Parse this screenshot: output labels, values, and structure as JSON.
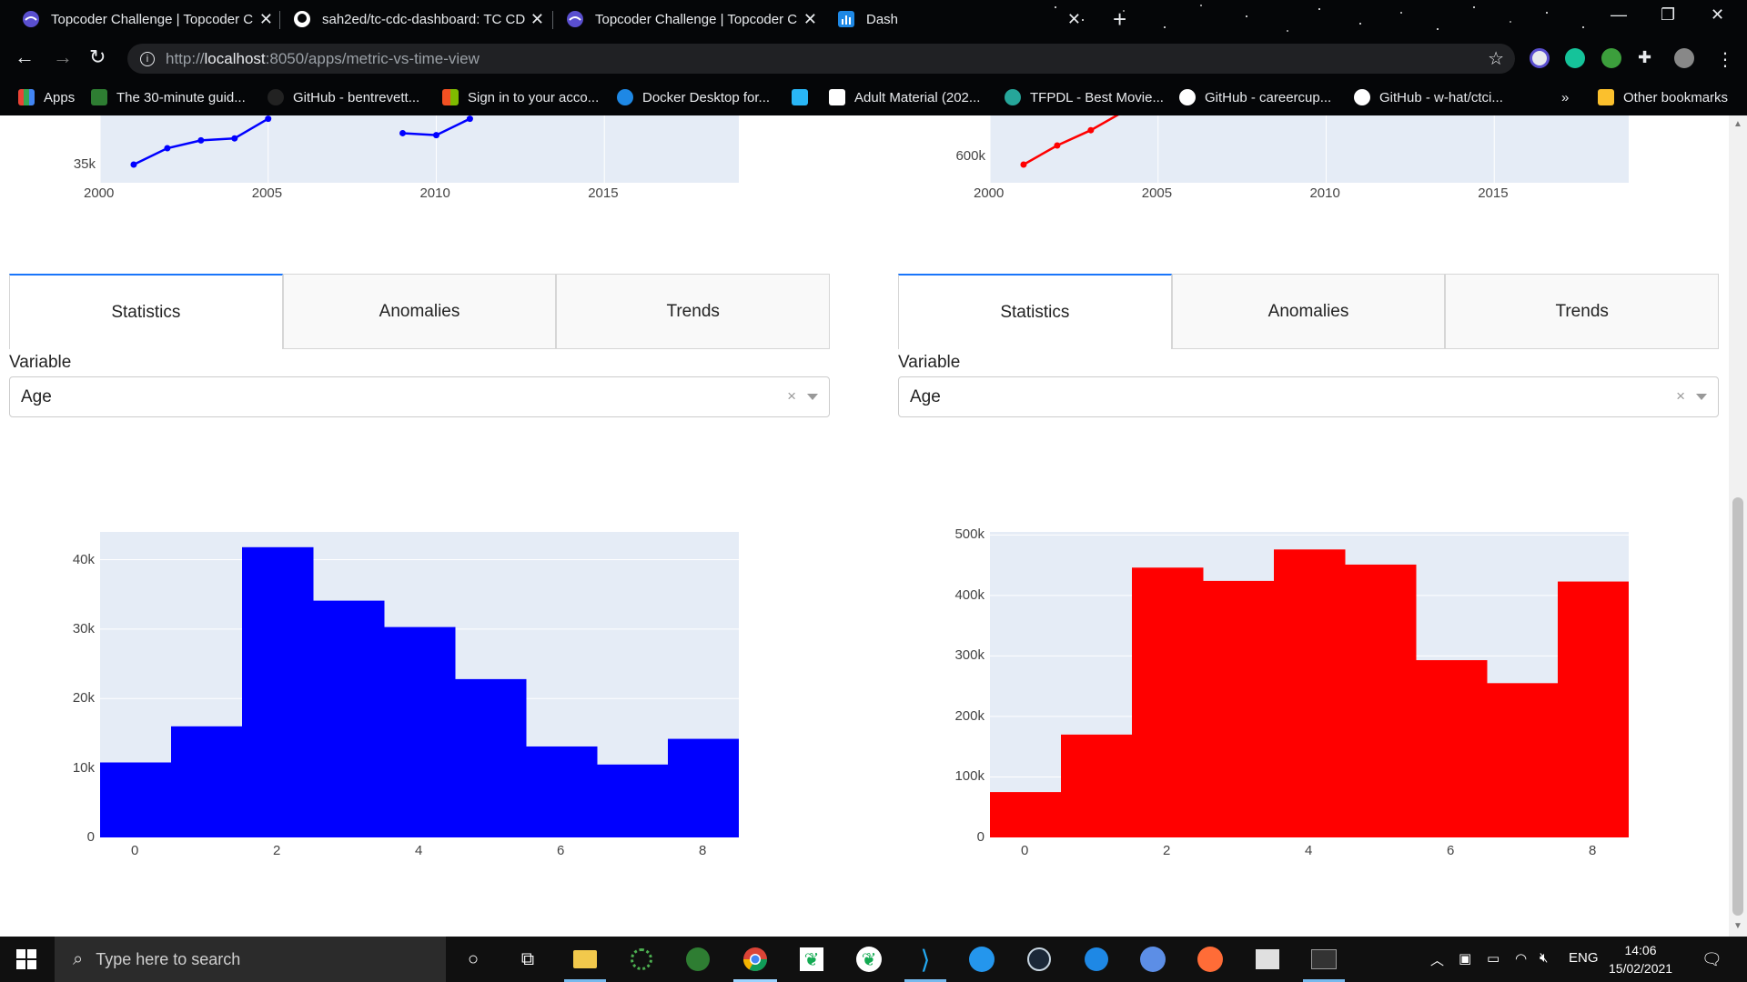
{
  "browser": {
    "tabs": [
      {
        "title": "Topcoder Challenge | Topcoder C",
        "icon": "topcoder-icon"
      },
      {
        "title": "sah2ed/tc-cdc-dashboard: TC CD",
        "icon": "github-icon"
      },
      {
        "title": "Topcoder Challenge | Topcoder C",
        "icon": "topcoder-icon"
      },
      {
        "title": "Dash",
        "icon": "dash-icon"
      }
    ],
    "url_prefix": "http://",
    "url_host": "localhost",
    "url_rest": ":8050/apps/metric-vs-time-view",
    "bookmarks": [
      {
        "label": "Apps"
      },
      {
        "label": "The 30-minute guid..."
      },
      {
        "label": "GitHub - bentrevett..."
      },
      {
        "label": "Sign in to your acco..."
      },
      {
        "label": "Docker Desktop for..."
      },
      {
        "label": ""
      },
      {
        "label": "Adult Material (202..."
      },
      {
        "label": "TFPDL - Best Movie..."
      },
      {
        "label": "GitHub - careercup..."
      },
      {
        "label": "GitHub - w-hat/ctci..."
      }
    ],
    "bookmarks_overflow": "»",
    "other_bookmarks": "Other bookmarks"
  },
  "panels": {
    "left": {
      "tabs": [
        "Statistics",
        "Anomalies",
        "Trends"
      ],
      "variable_label": "Variable",
      "variable_value": "Age",
      "clear_glyph": "×"
    },
    "right": {
      "tabs": [
        "Statistics",
        "Anomalies",
        "Trends"
      ],
      "variable_label": "Variable",
      "variable_value": "Age",
      "clear_glyph": "×"
    }
  },
  "chart_data": [
    {
      "type": "line",
      "panel": "left-top",
      "color": "#0000ff",
      "x": [
        2001,
        2002,
        2003,
        2004,
        2005,
        2009,
        2010,
        2011
      ],
      "y": [
        35000,
        37500,
        38700,
        39000,
        42000,
        39800,
        39500,
        42000
      ],
      "xticks": [
        "2000",
        "2005",
        "2010",
        "2015"
      ],
      "xlim": [
        2000,
        2019
      ],
      "ytick_labels": [
        "35k"
      ],
      "note": "only lower portion of chart visible"
    },
    {
      "type": "line",
      "panel": "right-top",
      "color": "#ff0000",
      "x": [
        2001,
        2002,
        2003,
        2004,
        2005
      ],
      "y": [
        600000,
        625000,
        645000,
        670000,
        710000
      ],
      "xticks": [
        "2000",
        "2005",
        "2010",
        "2015"
      ],
      "xlim": [
        2000,
        2019
      ],
      "ytick_labels": [
        "600k"
      ]
    },
    {
      "type": "bar",
      "panel": "left-bottom",
      "color": "#0000ff",
      "categories": [
        0,
        1,
        2,
        3,
        4,
        5,
        6,
        7,
        8
      ],
      "values": [
        10800,
        16000,
        41800,
        34100,
        30300,
        22800,
        13100,
        10500,
        14200
      ],
      "xticks": [
        "0",
        "2",
        "4",
        "6",
        "8"
      ],
      "yticks": [
        "0",
        "10k",
        "20k",
        "30k",
        "40k"
      ],
      "ylim": [
        0,
        44000
      ]
    },
    {
      "type": "bar",
      "panel": "right-bottom",
      "color": "#ff0000",
      "categories": [
        0,
        1,
        2,
        3,
        4,
        5,
        6,
        7,
        8
      ],
      "values": [
        75000,
        170000,
        446000,
        424000,
        476000,
        451000,
        293000,
        255000,
        423000
      ],
      "xticks": [
        "0",
        "2",
        "4",
        "6",
        "8"
      ],
      "yticks": [
        "0",
        "100k",
        "200k",
        "300k",
        "400k",
        "500k"
      ],
      "ylim": [
        0,
        505000
      ]
    }
  ],
  "taskbar": {
    "search_placeholder": "Type here to search",
    "language": "ENG",
    "time": "14:06",
    "date": "15/02/2021"
  }
}
